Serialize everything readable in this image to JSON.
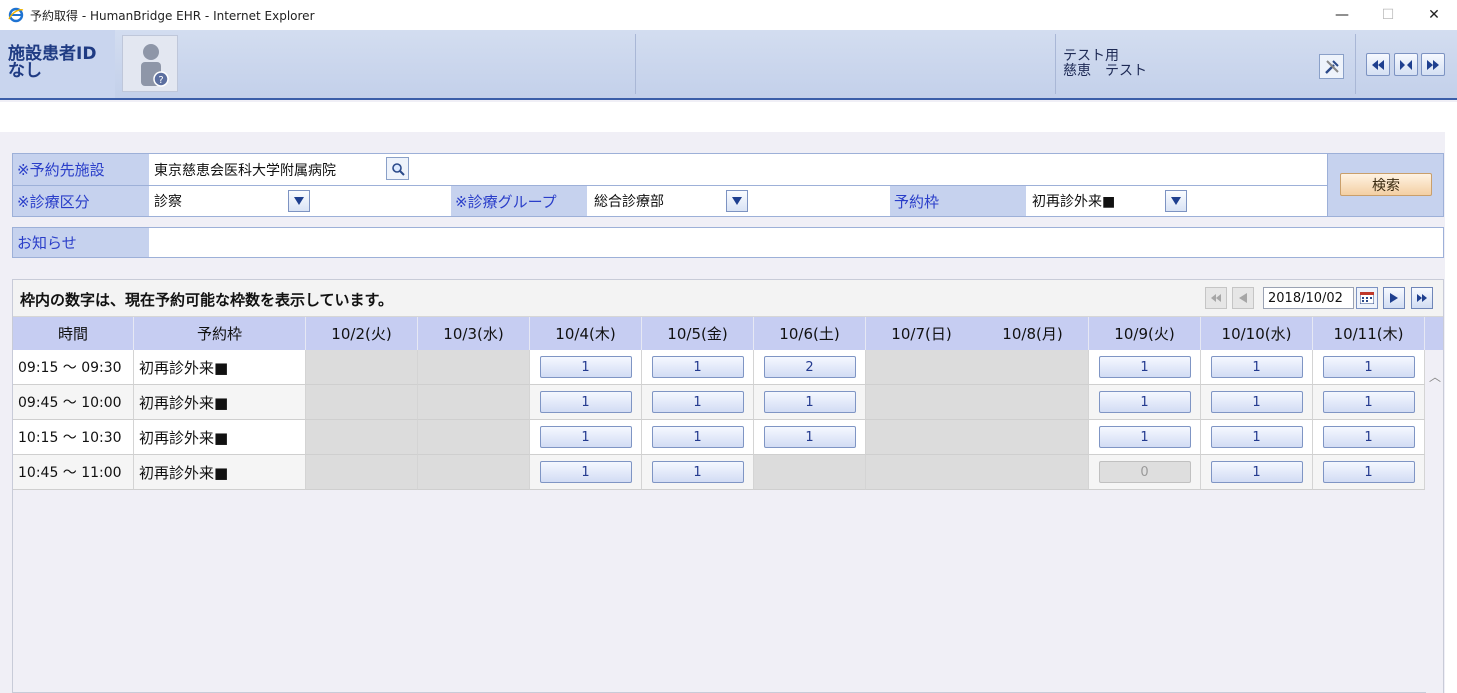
{
  "window": {
    "title": "予約取得 - HumanBridge EHR - Internet Explorer",
    "icon": "ie-icon",
    "minimize": "—",
    "maximize": "☐",
    "close": "✕"
  },
  "header": {
    "patient_id_line1": "施設患者ID",
    "patient_id_line2": "なし",
    "user_line1": "テスト用",
    "user_line2": "慈恵　テスト"
  },
  "form": {
    "facility_label": "※予約先施設",
    "facility_value": "東京慈恵会医科大学附属病院",
    "category_label": "※診療区分",
    "category_value": "診察",
    "group_label": "※診療グループ",
    "group_value": "総合診療部",
    "frame_label": "予約枠",
    "frame_value": "初再診外来■",
    "search_button": "検索",
    "notice_label": "お知らせ",
    "notice_value": ""
  },
  "schedule": {
    "note": "枠内の数字は、現在予約可能な枠数を表示しています。",
    "date": "2018/10/02",
    "columns": {
      "time": "時間",
      "slot": "予約枠",
      "days": [
        "10/2(火)",
        "10/3(水)",
        "10/4(木)",
        "10/5(金)",
        "10/6(土)",
        "10/7(日)",
        "10/8(月)",
        "10/9(火)",
        "10/10(水)",
        "10/11(木)"
      ]
    },
    "rows": [
      {
        "time": "09:15 ～ 09:30",
        "slot": "初再診外来■",
        "cells": [
          null,
          null,
          "1",
          "1",
          "2",
          null,
          null,
          "1",
          "1",
          "1"
        ]
      },
      {
        "time": "09:45 ～ 10:00",
        "slot": "初再診外来■",
        "cells": [
          null,
          null,
          "1",
          "1",
          "1",
          null,
          null,
          "1",
          "1",
          "1"
        ]
      },
      {
        "time": "10:15 ～ 10:30",
        "slot": "初再診外来■",
        "cells": [
          null,
          null,
          "1",
          "1",
          "1",
          null,
          null,
          "1",
          "1",
          "1"
        ]
      },
      {
        "time": "10:45 ～ 11:00",
        "slot": "初再診外来■",
        "cells": [
          null,
          null,
          "1",
          "1",
          null,
          null,
          null,
          "0",
          "1",
          "1"
        ]
      }
    ],
    "disabled_value": "0"
  },
  "colors": {
    "header_accent": "#3b5ea8",
    "label_bg": "#c6d2ee",
    "label_text": "#2a3ec9",
    "column_header_bg": "#c6cdf2",
    "unavailable_bg": "#dcdcdc"
  }
}
